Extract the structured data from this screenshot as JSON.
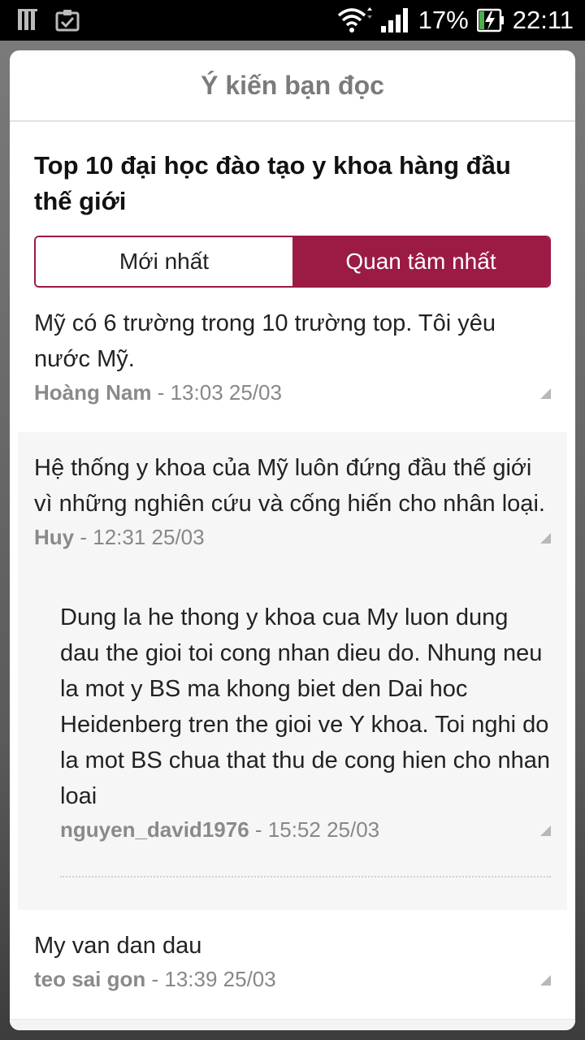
{
  "status_bar": {
    "battery_percent": "17%",
    "time": "22:11",
    "icons": [
      "notification-bars-icon",
      "clipboard-check-icon",
      "wifi-icon",
      "signal-icon",
      "battery-charging-icon"
    ]
  },
  "dialog": {
    "title": "Ý kiến bạn đọc",
    "article_title": "Top 10 đại học đào tạo y khoa hàng đầu thế giới",
    "tabs": [
      {
        "label": "Mới nhất",
        "active": false
      },
      {
        "label": "Quan tâm nhất",
        "active": true
      }
    ],
    "accent_color": "#9b1b45",
    "comments": [
      {
        "text": "Mỹ có 6 trường trong 10 trường top. Tôi yêu nước Mỹ.",
        "author": "Hoàng Nam",
        "time": "13:03 25/03"
      },
      {
        "text": "Hệ thống y khoa của Mỹ luôn đứng đầu thế giới vì những nghiên cứu và cống hiến cho nhân loại.",
        "author": "Huy",
        "time": "12:31 25/03",
        "replies": [
          {
            "text": "Dung la he thong y khoa cua My luon dung dau the gioi toi cong nhan dieu do. Nhung neu la mot y BS ma khong biet den Dai hoc Heidenberg tren the gioi ve Y khoa. Toi nghi do la mot BS chua that thu de cong hien cho nhan loai",
            "author": "nguyen_david1976",
            "time": "15:52 25/03"
          }
        ]
      },
      {
        "text": "My van dan dau",
        "author": "teo sai gon",
        "time": "13:39 25/03"
      }
    ]
  }
}
